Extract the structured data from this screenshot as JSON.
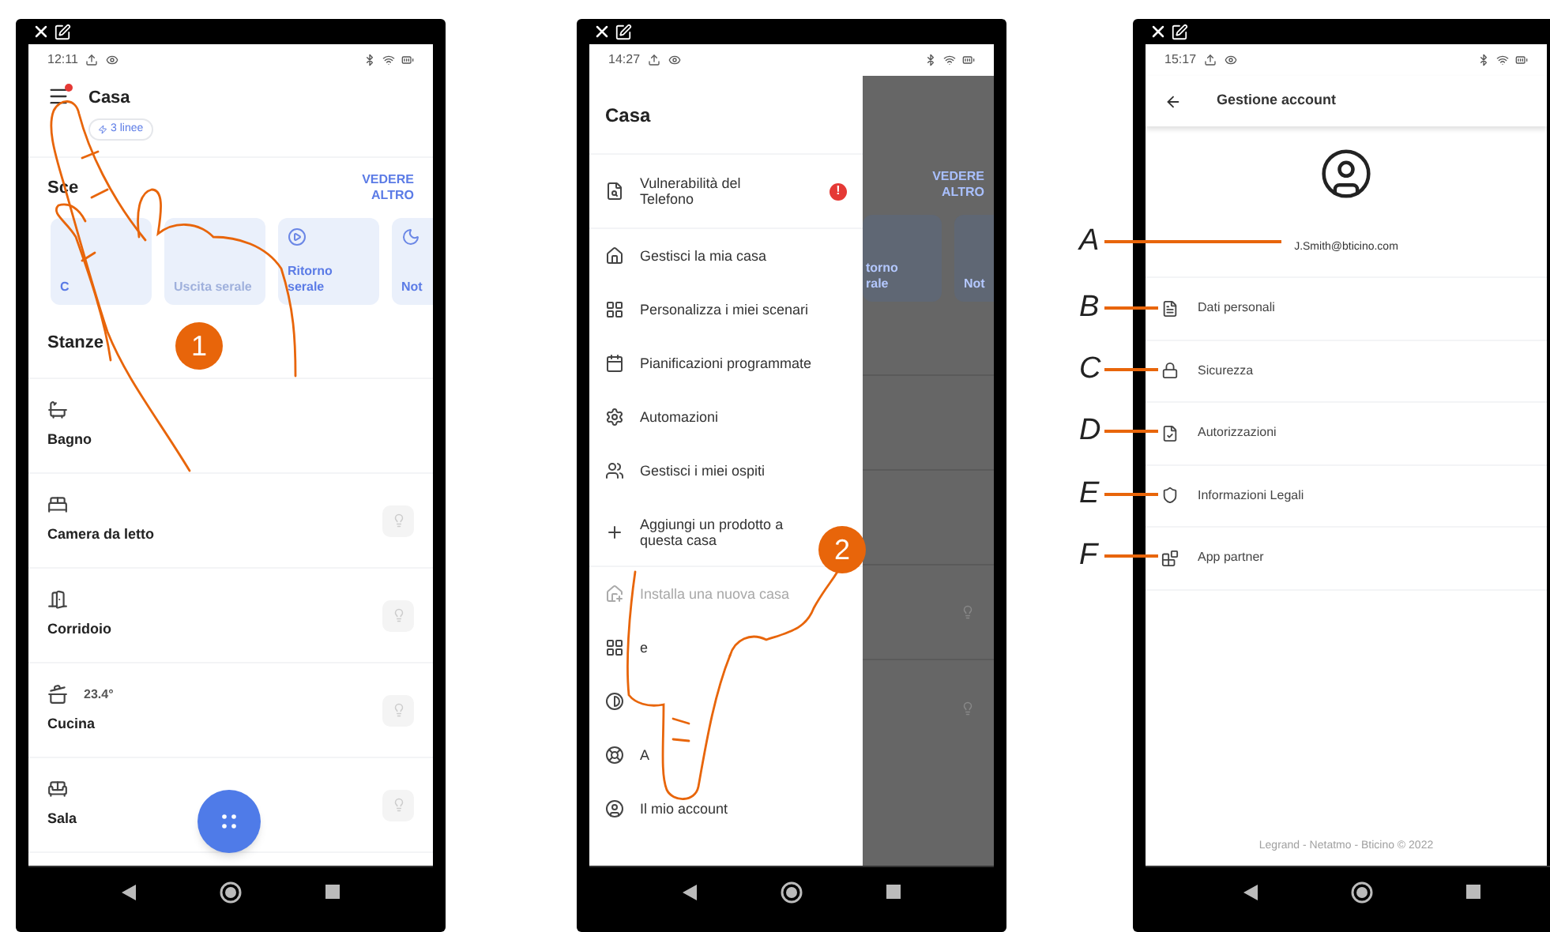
{
  "screen_1": {
    "time": "12:11",
    "title": "Casa",
    "notification_dot": true,
    "chip": "3 linee",
    "scenes_heading": "Sce",
    "see_more": "VEDERE ALTRO",
    "scenes": [
      {
        "label": "C",
        "disabled": false
      },
      {
        "label": "Uscita serale",
        "disabled": true
      },
      {
        "label": "Ritorno serale",
        "disabled": false
      },
      {
        "label": "Not",
        "disabled": false
      }
    ],
    "rooms_heading": "Stanze",
    "rooms": [
      {
        "name": "Bagno",
        "light_button": false
      },
      {
        "name": "Camera da letto",
        "light_button": true
      },
      {
        "name": "Corridoio",
        "light_button": true
      },
      {
        "name": "Cucina",
        "reading": "23.4°",
        "light_button": true
      },
      {
        "name": "Sala",
        "light_button": true
      }
    ],
    "step": "1"
  },
  "screen_2": {
    "time": "14:27",
    "drawer_title": "Casa",
    "alert_item": {
      "label": "Vulnerabilità del Telefono",
      "badge": "!"
    },
    "menu": [
      {
        "label": "Gestisci la mia casa",
        "disabled": false
      },
      {
        "label": "Personalizza i miei scenari",
        "disabled": false
      },
      {
        "label": "Pianificazioni programmate",
        "disabled": false
      },
      {
        "label": "Automazioni",
        "disabled": false
      },
      {
        "label": "Gestisci i miei ospiti",
        "disabled": false
      },
      {
        "label": "Aggiungi un prodotto a questa casa",
        "disabled": false
      }
    ],
    "menu_2": [
      {
        "label": "Installa una nuova casa",
        "disabled": true
      },
      {
        "label": "e",
        "disabled": false
      },
      {
        "disabled": false
      },
      {
        "label": "A",
        "disabled": false
      },
      {
        "label": "Il mio account",
        "disabled": false
      }
    ],
    "see_more": "VEDERE ALTRO",
    "bg_scenes": [
      "torno rale",
      "Not"
    ],
    "step": "2"
  },
  "screen_3": {
    "time": "15:17",
    "title": "Gestione account",
    "email": "J.Smith@bticino.com",
    "rows": [
      "Dati personali",
      "Sicurezza",
      "Autorizzazioni",
      "Informazioni Legali",
      "App partner"
    ],
    "footer": "Legrand - Netatmo - Bticino © 2022",
    "callouts": [
      "A",
      "B",
      "C",
      "D",
      "E",
      "F"
    ]
  }
}
